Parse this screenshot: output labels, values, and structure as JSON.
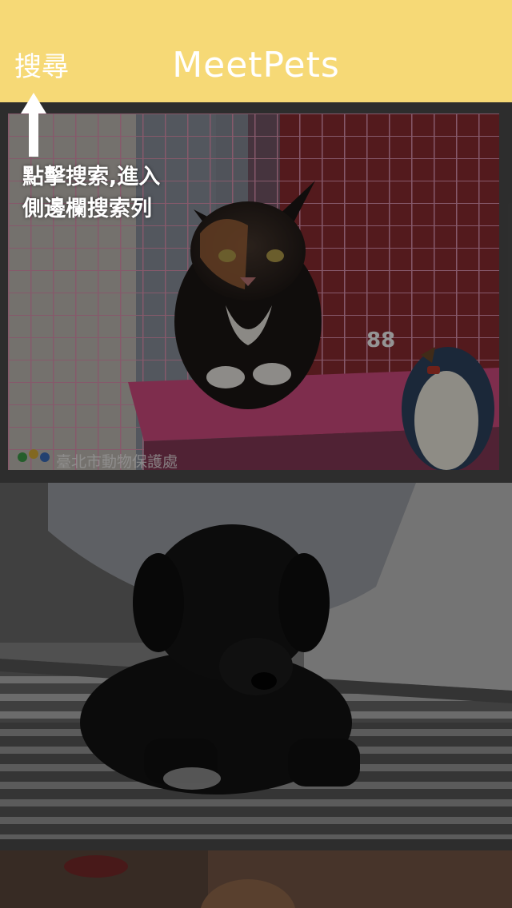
{
  "navbar": {
    "search_label": "搜尋",
    "title": "MeetPets",
    "background": "#f6d976"
  },
  "onboarding": {
    "hint_line1": "點擊搜索,進入",
    "hint_line2": "側邊欄搜索列"
  },
  "pets": [
    {
      "photo_watermark": "臺北市動物保護處",
      "sticker_text": "88"
    },
    {},
    {}
  ]
}
